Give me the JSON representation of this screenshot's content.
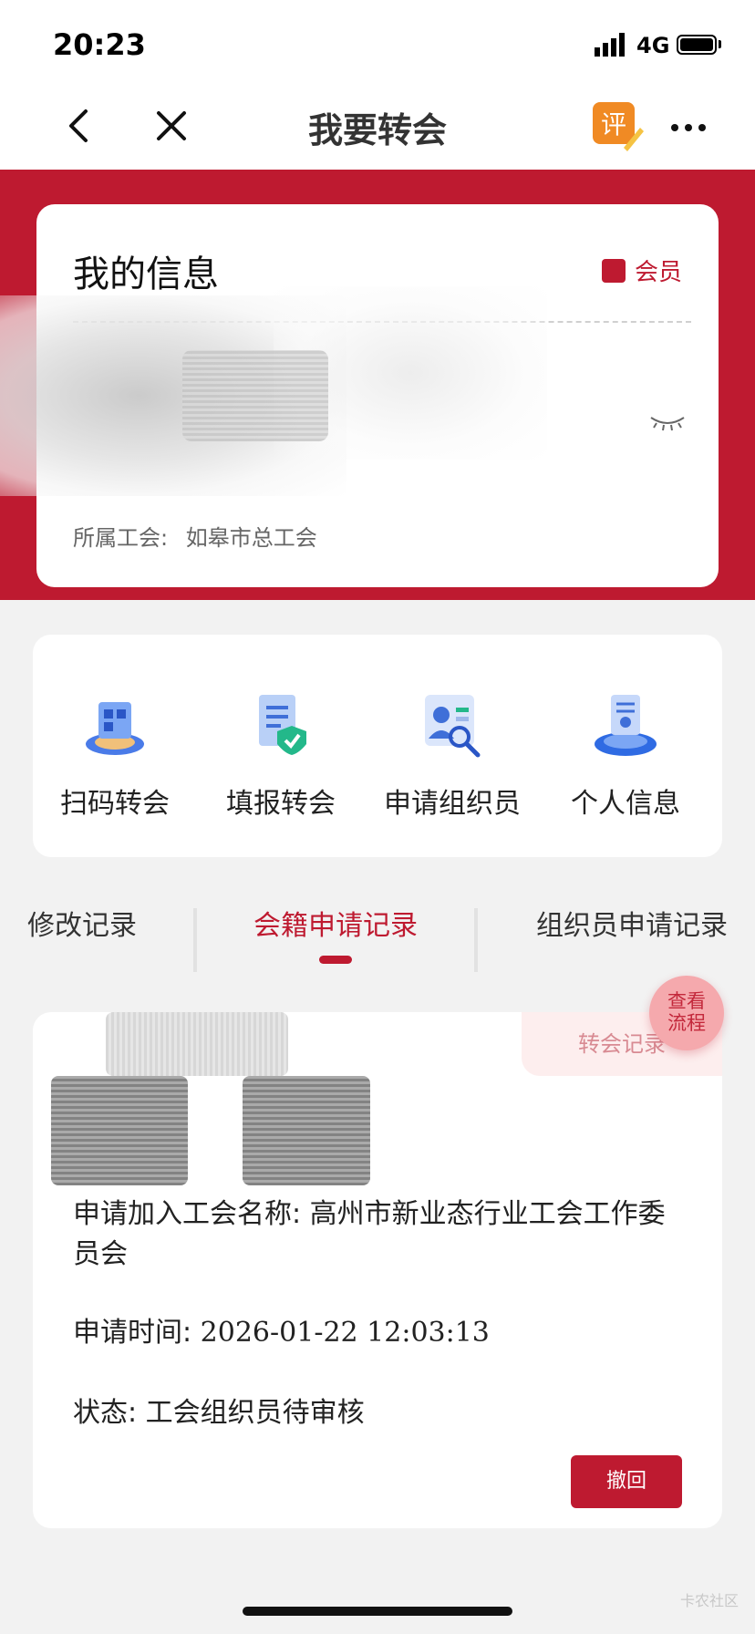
{
  "status_bar": {
    "time": "20:23",
    "network": "4G"
  },
  "nav": {
    "title": "我要转会",
    "rate_icon_text": "评"
  },
  "info": {
    "title": "我的信息",
    "badge": "会员",
    "union_label": "所属工会:",
    "union_value": "如皋市总工会"
  },
  "menu": [
    {
      "label": "扫码转会",
      "icon": "scan-transfer-icon"
    },
    {
      "label": "填报转会",
      "icon": "form-transfer-icon"
    },
    {
      "label": "申请组织员",
      "icon": "organizer-apply-icon"
    },
    {
      "label": "个人信息",
      "icon": "personal-info-icon"
    }
  ],
  "tabs": [
    {
      "label": "修改记录",
      "active": false
    },
    {
      "label": "会籍申请记录",
      "active": true
    },
    {
      "label": "组织员申请记录",
      "active": false
    }
  ],
  "record": {
    "tag": "转会记录",
    "union_name_label": "申请加入工会名称:",
    "union_name_value": "高州市新业态行业工会工作委员会",
    "time_label": "申请时间:",
    "time_value": "2026-01-22 12:03:13",
    "status_label": "状态:",
    "status_value": "工会组织员待审核",
    "withdraw_label": "撤回"
  },
  "float_bubble": {
    "line1": "查看",
    "line2": "流程"
  },
  "watermark": "卡农社区",
  "colors": {
    "brand_red": "#be1a30",
    "tag_bg": "#fdeeee"
  }
}
